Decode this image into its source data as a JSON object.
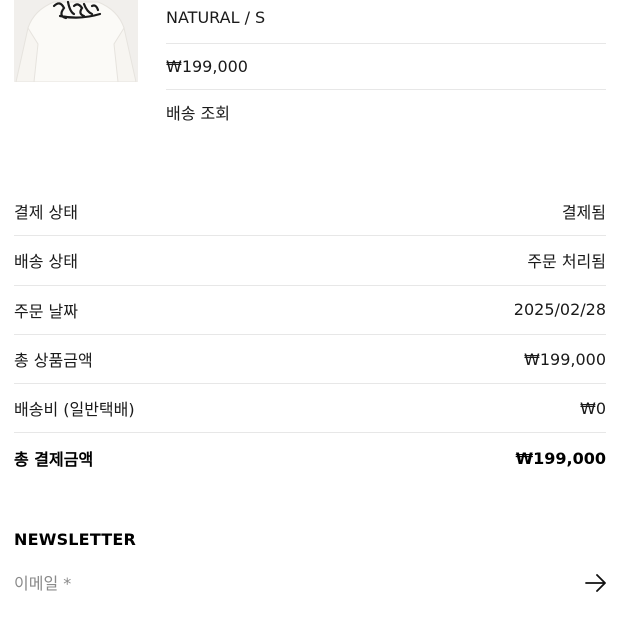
{
  "product": {
    "image_alt": "stussy hoodie",
    "variant": "NATURAL / S",
    "price": "₩199,000",
    "track_delivery": "배송 조회"
  },
  "summary": {
    "rows": [
      {
        "label": "결제 상태",
        "value": "결제됨"
      },
      {
        "label": "배송 상태",
        "value": "주문 처리됨"
      },
      {
        "label": "주문 날짜",
        "value": "2025/02/28"
      },
      {
        "label": "총 상품금액",
        "value": "₩199,000"
      },
      {
        "label": "배송비 (일반택배)",
        "value": "₩0"
      }
    ],
    "total": {
      "label": "총 결제금액",
      "value": "₩199,000"
    }
  },
  "newsletter": {
    "title": "NEWSLETTER",
    "email_placeholder": "이메일 *",
    "submit_icon": "arrow-right-icon"
  },
  "colors": {
    "thumb_bg": "#f1efec",
    "divider": "#e7e7e7",
    "text": "#1a1a1a",
    "placeholder": "#8a8a8a"
  }
}
